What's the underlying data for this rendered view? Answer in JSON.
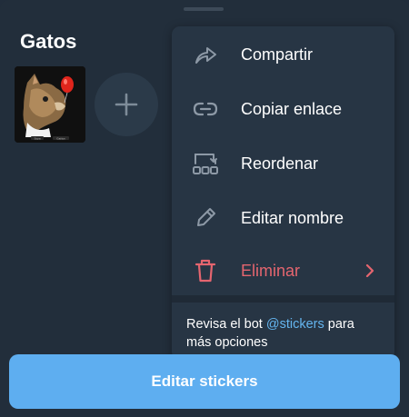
{
  "pack": {
    "title": "Gatos",
    "sticker_thumb_tag_left": "Sopa",
    "sticker_thumb_tag_right": "Gatitos"
  },
  "menu": {
    "items": [
      {
        "label": "Compartir",
        "icon": "share-icon"
      },
      {
        "label": "Copiar enlace",
        "icon": "link-icon"
      },
      {
        "label": "Reordenar",
        "icon": "reorder-icon"
      },
      {
        "label": "Editar nombre",
        "icon": "pencil-icon"
      },
      {
        "label": "Eliminar",
        "icon": "trash-icon",
        "danger": true
      }
    ],
    "hint_prefix": "Revisa el bot ",
    "hint_link": "@stickers",
    "hint_suffix": " para más opciones"
  },
  "footer": {
    "button_label": "Editar stickers"
  },
  "colors": {
    "background": "#222e3b",
    "menu": "#273544",
    "accent": "#5eaef0",
    "danger": "#e5656f",
    "link": "#64b5ef"
  }
}
